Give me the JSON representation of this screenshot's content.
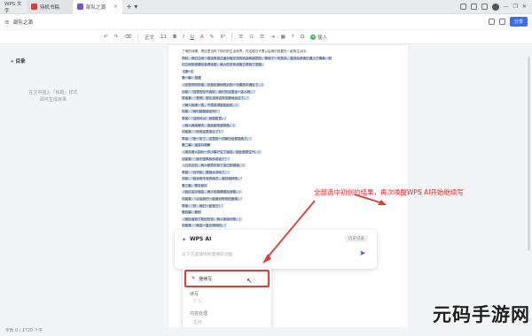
{
  "tabs": [
    {
      "label": "WPS 文字"
    },
    {
      "label": "待机书稿"
    },
    {
      "label": "部队之源",
      "active": true
    }
  ],
  "doc": {
    "title": "部队之源",
    "share_label": "分享"
  },
  "toolbar": {
    "style": "正文",
    "size": "11",
    "bold": "B",
    "italic": "I",
    "underline": "U",
    "font_color": "A",
    "insert_label": "插入"
  },
  "sidebar": {
    "title": "目录",
    "empty_line1": "在文中插入「标题」样式",
    "empty_line2": "即可生成目录"
  },
  "document_lines": [
    {
      "text": "了他的诗情，把这里当作了他们的生活世界。在这段日子里以后他们还要在一起的生活中。",
      "selected": false
    },
    {
      "text": "同时，他们之间一直没有真正面对面交流的机会和诚意的。等到了一切变化，直到后来他们遇上了情事，他",
      "selected": true
    },
    {
      "text": "们之间的感情也变得亲密，两人的关系也随之得到了发展。",
      "selected": true
    },
    {
      "text": "【第一】",
      "selected": true
    },
    {
      "text": "第一幕：相遇",
      "selected": true
    },
    {
      "text": "（在很早的时候，在部队营地附近的一次偶然中遇见了。）",
      "selected": true
    },
    {
      "text": "刘某：“这里的空气真好，我们在这里坐一会儿吧。”",
      "selected": true
    },
    {
      "text": "李某某：“是啊，很久没有这样安静地坐过了。”",
      "selected": true
    },
    {
      "text": "（两人相视一笑，气氛变得轻松起来。）",
      "selected": true
    },
    {
      "text": "刘某：“我们能做朋友吗？”",
      "selected": true
    },
    {
      "text": "李某：“当然可以！我很愿意。”",
      "selected": true
    },
    {
      "text": "（两人继续聊天，彼此越来越熟悉。）",
      "selected": true
    },
    {
      "text": "刘某某：“你来这里多久了？”",
      "selected": true
    },
    {
      "text": "李某：“快一年了，这里的一切都已经很熟悉了。”",
      "selected": true
    },
    {
      "text": "第二幕：误会与和解",
      "selected": true
    },
    {
      "text": "（某天两人因为一件小事产生了误会，彼此都很生气。）",
      "selected": true
    },
    {
      "text": "刘某某：“我不想再和你说话了！”",
      "selected": true
    },
    {
      "text": "（几天过去，两人都意识到了自己的错误。）",
      "selected": true
    },
    {
      "text": "李某：“对不起，是我太冲动了。”",
      "selected": true
    },
    {
      "text": "刘某：“我也有不对的地方，我们和好吧。”",
      "selected": true
    },
    {
      "text": "第三幕：携手前行",
      "selected": true
    },
    {
      "text": "（经过这次误会，两人的感情更加深厚。）",
      "selected": true
    },
    {
      "text": "刘某某：“以后我们一起面对所有的困难。”",
      "selected": true
    },
    {
      "text": "李某：“好，我们一起努力！”",
      "selected": true
    },
    {
      "text": "第四幕：离别",
      "selected": true
    },
    {
      "text": "（部队接到了新的任务，两人即将分别。）",
      "selected": true
    },
    {
      "text": "刘某某：“我会一直记得你的。”",
      "selected": true
    },
    {
      "text": "李某：“我也是，希望我们还能再见面。”",
      "selected": true
    },
    {
      "text": "（两人紧紧拥抱，依依不舍地告别。）",
      "selected": true
    },
    {
      "text": "刘某：“保重！”",
      "selected": true
    },
    {
      "text": "李某：“你也是，一路平安。”",
      "selected": true
    }
  ],
  "ai_panel": {
    "title": "WPS AI",
    "history_label": "历史记录",
    "input_placeholder": "从下方选择你所需要的功能",
    "menu": {
      "continue_label": "继续写",
      "section1": "续写",
      "section1_item": "扩写",
      "section2": "内容处理",
      "section2_item": "总结"
    }
  },
  "annotation": {
    "text": "全部选中初创的结果，再次唤醒WPS AI开始继续写",
    "color": "#e8242b"
  },
  "statusbar": {
    "text": "字数 0 / 1720 个字"
  },
  "watermark": {
    "text": "元码手游网"
  },
  "colors": {
    "accent": "#3b6cf5",
    "selection": "#c9dbf5",
    "highlight_border": "#e53935"
  }
}
